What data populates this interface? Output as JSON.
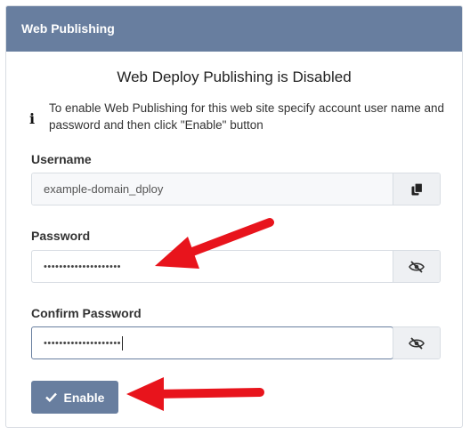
{
  "panel": {
    "title": "Web Publishing",
    "heading": "Web Deploy Publishing is Disabled",
    "info_icon": "info-icon",
    "info_text": "To enable Web Publishing for this web site specify account user name and password and then click \"Enable\" button"
  },
  "username": {
    "label": "Username",
    "value": "example-domain_dploy",
    "button_icon": "copy-icon"
  },
  "password": {
    "label": "Password",
    "masked_value": "••••••••••••••••••••",
    "button_icon": "eye-slash-icon"
  },
  "confirm_password": {
    "label": "Confirm Password",
    "masked_value": "••••••••••••••••••••",
    "button_icon": "eye-slash-icon"
  },
  "enable_button": {
    "label": "Enable",
    "icon": "checkmark-icon"
  },
  "annotations": {
    "arrow_color": "#e8141c"
  },
  "colors": {
    "header": "#687e9f",
    "button": "#687e9f"
  }
}
